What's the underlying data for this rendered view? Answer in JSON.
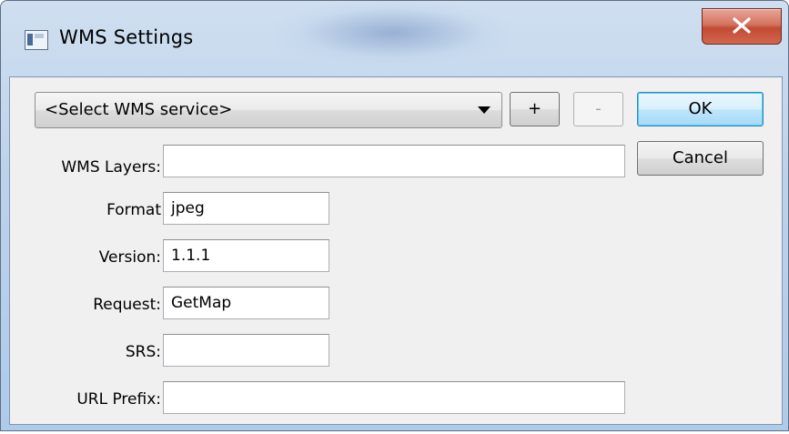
{
  "window": {
    "title": "WMS Settings"
  },
  "service_select": {
    "selected": "<Select WMS service>"
  },
  "buttons": {
    "add": "+",
    "remove": "-",
    "ok": "OK",
    "cancel": "Cancel"
  },
  "fields": {
    "layers": {
      "label": "WMS Layers:",
      "value": ""
    },
    "format": {
      "label": "Format",
      "value": "jpeg"
    },
    "version": {
      "label": "Version:",
      "value": "1.1.1"
    },
    "request": {
      "label": "Request:",
      "value": "GetMap"
    },
    "srs": {
      "label": "SRS:",
      "value": ""
    },
    "url_prefix": {
      "label": "URL Prefix:",
      "value": ""
    }
  },
  "icons": {
    "app": "window-app-icon",
    "close": "close-x-icon",
    "dropdown": "chevron-down-icon"
  }
}
